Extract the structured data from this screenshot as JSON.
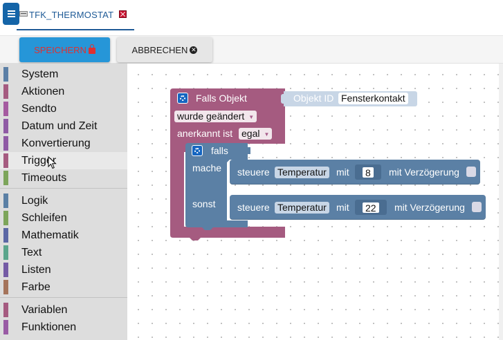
{
  "tab": {
    "title": "TFK_THERMOSTAT"
  },
  "toolbar": {
    "save_label": "SPEICHERN",
    "cancel_label": "ABBRECHEN"
  },
  "colors": {
    "accent": "#2696d8",
    "save_text": "#e03030",
    "trigger_block": "#a55b80",
    "logic_block": "#5b80a5",
    "workspace_bg": "#ffffff",
    "sidebar_bg": "#dddddd"
  },
  "sidebar": {
    "categories": [
      {
        "label": "System",
        "color": "#5b7fa6"
      },
      {
        "label": "Aktionen",
        "color": "#a55b80"
      },
      {
        "label": "Sendto",
        "color": "#a55ba0"
      },
      {
        "label": "Datum und Zeit",
        "color": "#8f5ba5"
      },
      {
        "label": "Konvertierung",
        "color": "#8f5ba5"
      },
      {
        "label": "Trigger",
        "color": "#a55b80"
      },
      {
        "label": "Timeouts",
        "color": "#7da55b"
      },
      {
        "label": "Logik",
        "color": "#5b80a5"
      },
      {
        "label": "Schleifen",
        "color": "#7da55b"
      },
      {
        "label": "Mathematik",
        "color": "#5b67a5"
      },
      {
        "label": "Text",
        "color": "#5ba58c"
      },
      {
        "label": "Listen",
        "color": "#745ba5"
      },
      {
        "label": "Farbe",
        "color": "#a5745b"
      },
      {
        "label": "Variablen",
        "color": "#a55b80"
      },
      {
        "label": "Funktionen",
        "color": "#995ba5"
      }
    ]
  },
  "blocks": {
    "trigger": {
      "title": "Falls Objekt",
      "object_id_label": "Objekt ID",
      "object_id_value": "Fensterkontakt",
      "change_option": "wurde geändert",
      "ack_label": "anerkannt ist",
      "ack_option": "egal"
    },
    "if_block": {
      "label": "falls",
      "then_label": "mache",
      "else_label": "sonst"
    },
    "control_then": {
      "steuere_label": "steuere",
      "target": "Temperatur",
      "mit_label": "mit",
      "value": "8",
      "delay_label": "mit Verzögerung"
    },
    "control_else": {
      "steuere_label": "steuere",
      "target": "Temperatur",
      "mit_label": "mit",
      "value": "22",
      "delay_label": "mit Verzögerung"
    }
  }
}
